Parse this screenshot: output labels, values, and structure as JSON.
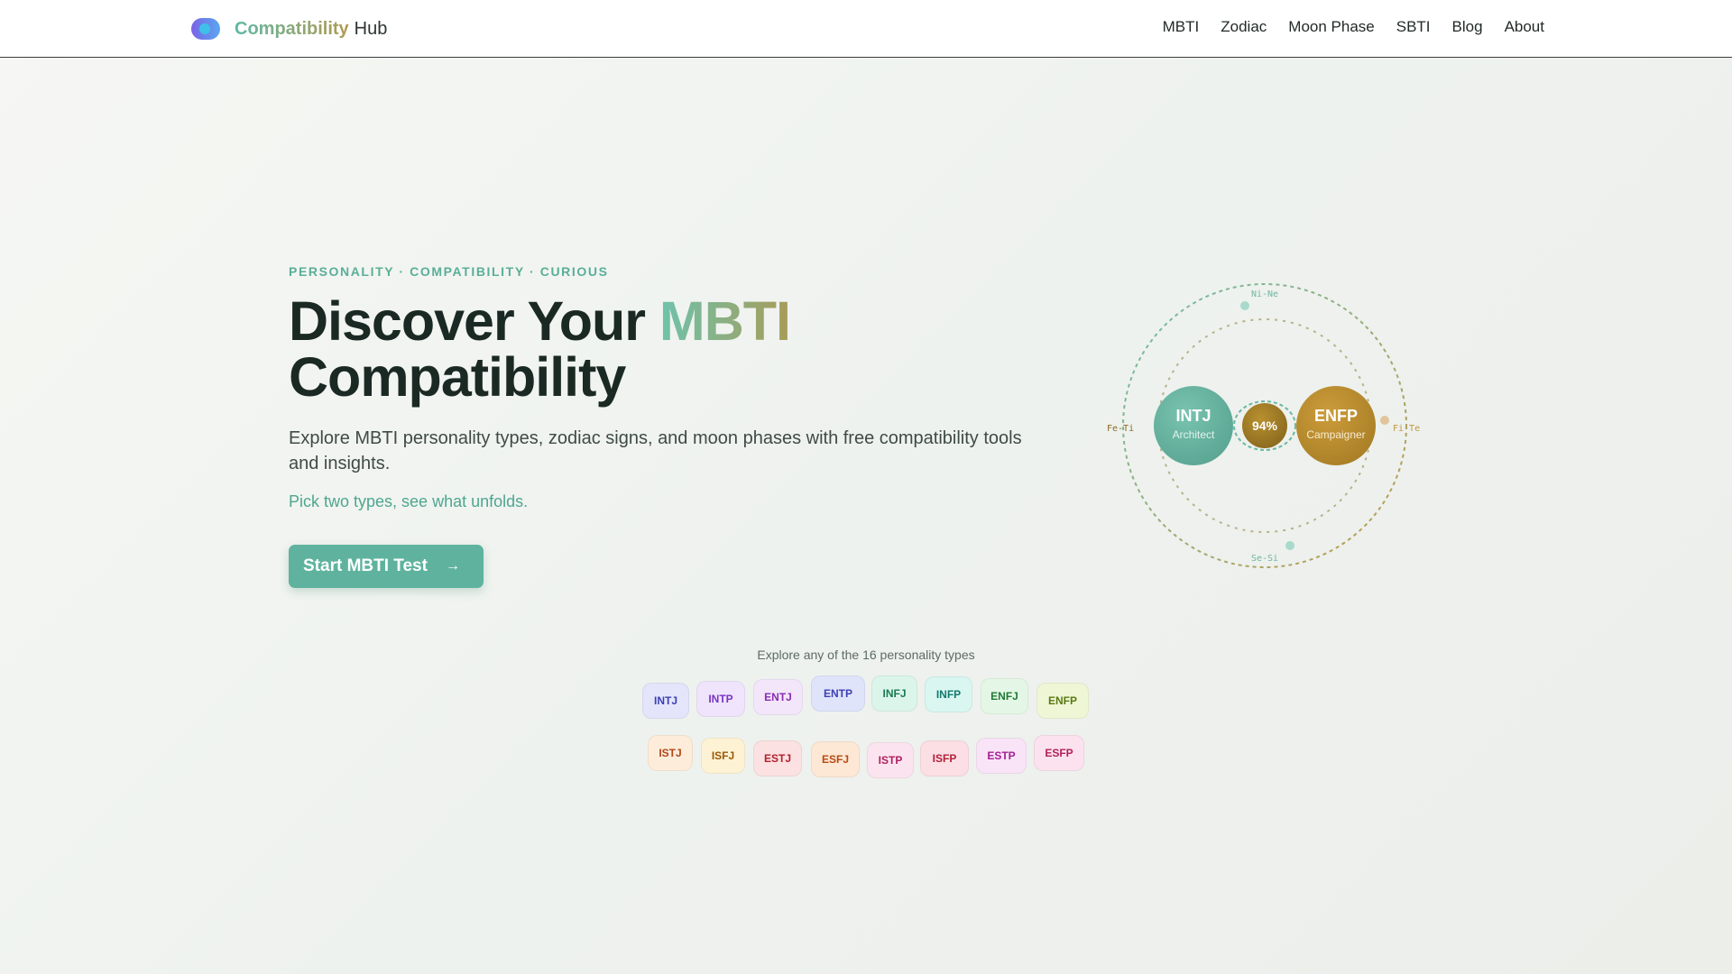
{
  "brand": {
    "name_a": "Compatibility",
    "name_b": "Hub",
    "logo_icon": "overlapping-circles-icon"
  },
  "nav": {
    "items": [
      "MBTI",
      "Zodiac",
      "Moon Phase",
      "SBTI",
      "Blog",
      "About"
    ]
  },
  "hero": {
    "eyebrow": "PERSONALITY · COMPATIBILITY · CURIOUS",
    "title_part1": "Discover Your",
    "title_accent": "MBTI",
    "title_part2": "Compatibility",
    "subtitle": "Explore MBTI personality types, zodiac signs, and moon phases with free compatibility tools and insights.",
    "note": "Pick two types, see what unfolds.",
    "cta_label": "Start MBTI Test",
    "cta_icon": "arrow-right-icon"
  },
  "orbit": {
    "left_type": "INTJ",
    "left_name": "Architect",
    "right_type": "ENFP",
    "right_name": "Campaigner",
    "score": "94%",
    "labels": {
      "top": "Ni-Ne",
      "bottom": "Se-Si",
      "left": "Fe-Ti",
      "right": "Fi-Te"
    },
    "colors": {
      "left": "#5fae9c",
      "right": "#b88a2e",
      "center": "#9a7424"
    }
  },
  "types": {
    "caption": "Explore any of the 16 personality types",
    "row1": [
      "INTJ",
      "INTP",
      "ENTJ",
      "ENTP",
      "INFJ",
      "INFP",
      "ENFJ",
      "ENFP"
    ],
    "row2": [
      "ISTJ",
      "ISFJ",
      "ESTJ",
      "ESFJ",
      "ISTP",
      "ISFP",
      "ESTP",
      "ESFP"
    ]
  }
}
